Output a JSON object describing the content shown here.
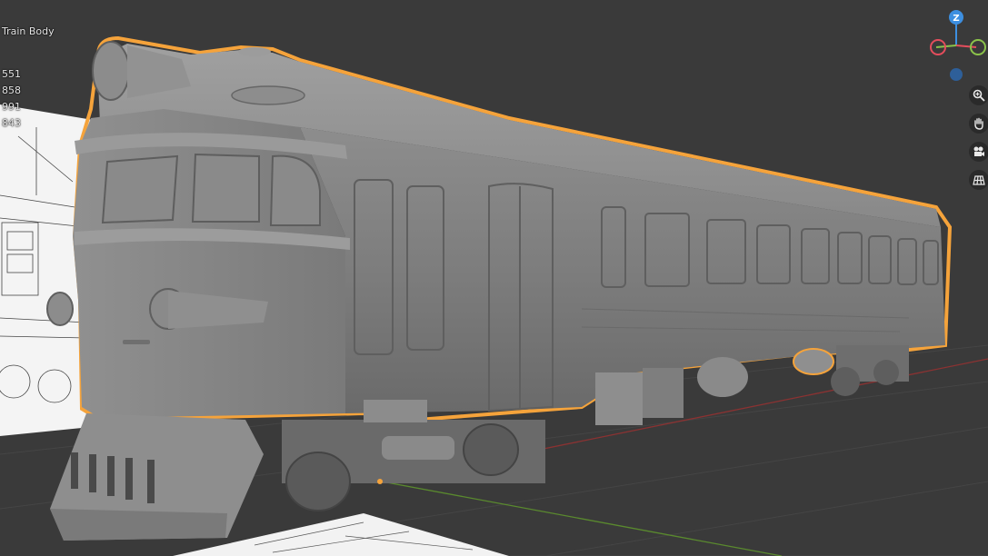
{
  "viewport": {
    "object_name": "Train Body",
    "stats": [
      "551",
      "858",
      "991",
      "843"
    ],
    "gizmo": {
      "z_label": "Z",
      "x_color": "#e44d5c",
      "y_color": "#8bc34a",
      "z_color": "#3d8fe0"
    },
    "nav_icons": [
      "zoom-icon",
      "pan-hand-icon",
      "camera-icon",
      "grid-view-icon"
    ],
    "selection_color": "#f5a33b",
    "x_axis_color": "#9a3a3a",
    "y_axis_color": "#5a8a2e"
  }
}
